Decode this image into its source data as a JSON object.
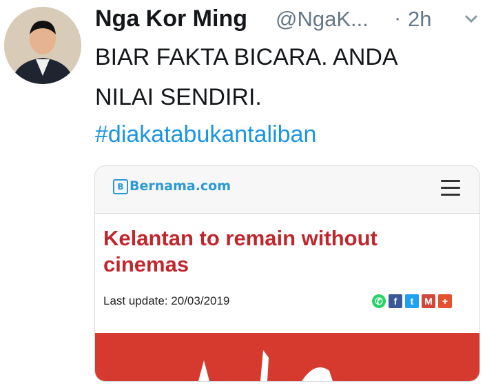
{
  "tweet": {
    "author_name": "Nga Kor Ming",
    "handle": "@NgaK...",
    "separator": "·",
    "time": "2h",
    "text_lines": [
      "BIAR FAKTA BICARA. ANDA",
      "NILAI SENDIRI."
    ],
    "hashtag": "#diakatabukantaliban"
  },
  "card": {
    "site_name": "Bernama.com",
    "site_logo_letter": "B",
    "headline": "Kelantan to remain without cinemas",
    "last_update": "Last update: 20/03/2019",
    "share_icons": [
      {
        "name": "whatsapp-icon",
        "color": "#25d366",
        "glyph": "✆"
      },
      {
        "name": "facebook-icon",
        "color": "#3b5998",
        "glyph": "f"
      },
      {
        "name": "twitter-icon",
        "color": "#1da1f2",
        "glyph": "t"
      },
      {
        "name": "gmail-icon",
        "color": "#d44638",
        "glyph": "M"
      },
      {
        "name": "more-share-icon",
        "color": "#e4512f",
        "glyph": "+"
      }
    ]
  },
  "colors": {
    "link_blue": "#1b95e0",
    "headline_red": "#c0272d",
    "brand_blue": "#2a99d4",
    "photo_red": "#d63a2f"
  }
}
